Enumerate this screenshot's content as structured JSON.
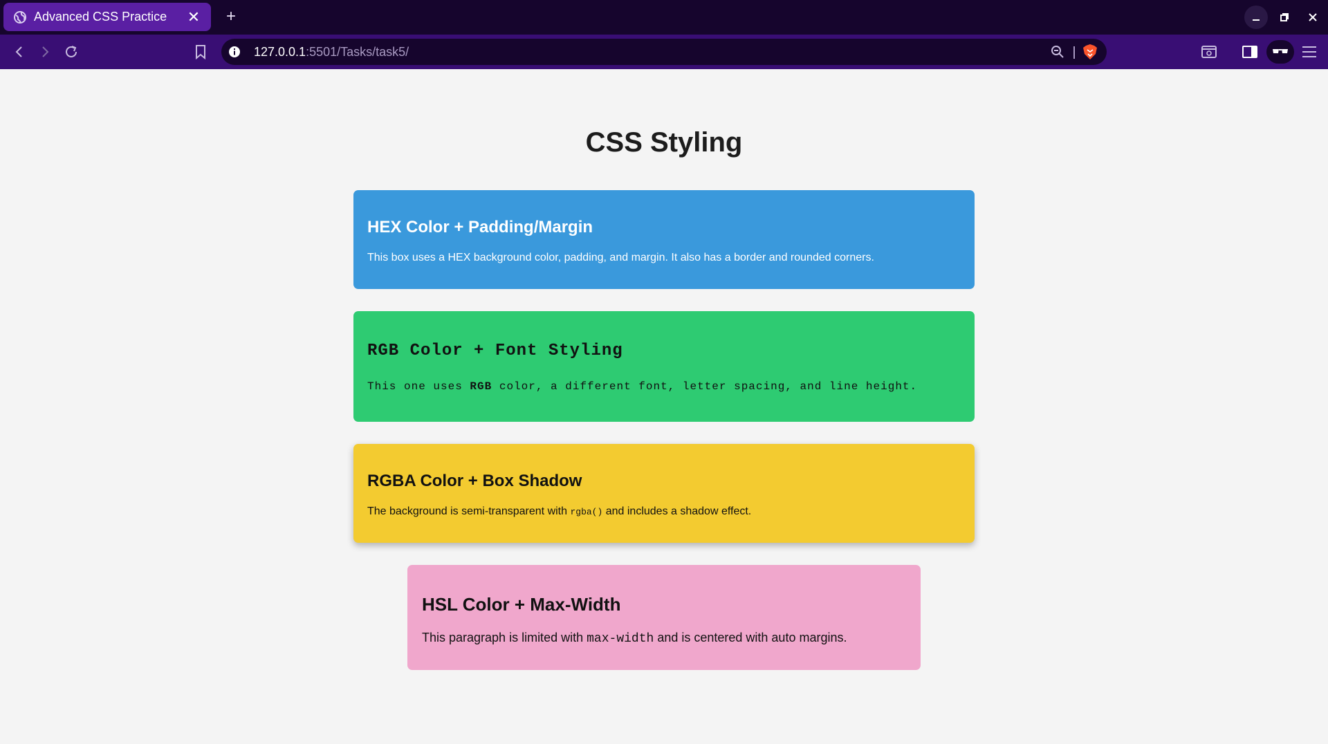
{
  "browser": {
    "tab_title": "Advanced CSS Practice",
    "tab_close_glyph": "✕",
    "new_tab_glyph": "+",
    "url_host": "127.0.0.1",
    "url_path": ":5501/Tasks/task5/",
    "icons": {
      "favicon": "globe-icon",
      "back": "back-arrow-icon",
      "forward": "forward-arrow-icon",
      "reload": "reload-icon",
      "bookmark": "bookmark-icon",
      "site_info": "info-icon",
      "zoom": "zoom-out-icon",
      "shields": "brave-lion-icon",
      "screenshot": "capture-icon",
      "sidebar": "sidebar-icon",
      "vpn": "glasses-icon",
      "menu": "hamburger-menu-icon",
      "minimize": "minimize-icon",
      "restore": "restore-icon",
      "close_window": "close-icon"
    },
    "colors": {
      "tab_strip": "#16052d",
      "active_tab": "#5a1fa3",
      "toolbar": "#390e74",
      "brave_orange": "#fb542b"
    }
  },
  "page": {
    "title": "CSS Styling",
    "background": "#f4f4f4",
    "boxes": [
      {
        "heading": "HEX Color + Padding/Margin",
        "text": "This box uses a HEX background color, padding, and margin. It also has a border and rounded corners.",
        "color": "#3a99dc"
      },
      {
        "heading": "RGB Color + Font Styling",
        "text_before": "This one uses ",
        "text_bold": "RGB",
        "text_after": " color, a different font, letter spacing, and line height.",
        "color": "#2ecb72"
      },
      {
        "heading": "RGBA Color + Box Shadow",
        "text_before": "The background is semi-transparent with ",
        "text_code": "rgba()",
        "text_after": " and includes a shadow effect.",
        "color": "#f3cb30"
      },
      {
        "heading": "HSL Color + Max-Width",
        "text_before": "This paragraph is limited with ",
        "text_code": "max-width",
        "text_after": " and is centered with auto margins.",
        "color": "#f0a7cc"
      }
    ]
  }
}
